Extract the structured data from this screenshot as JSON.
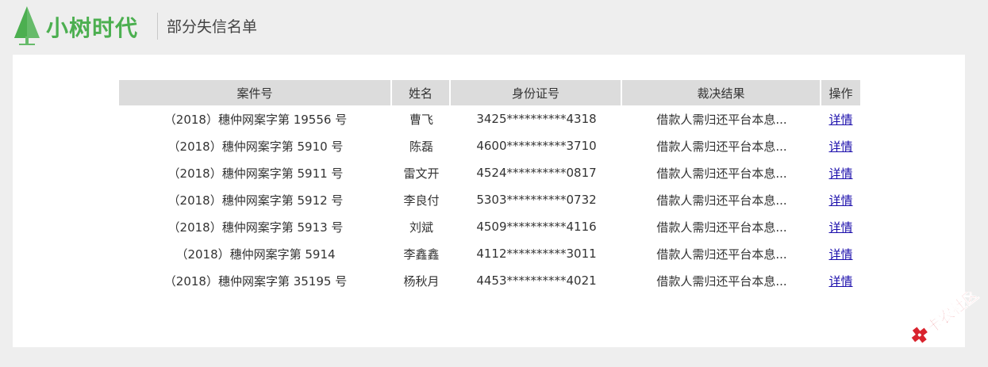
{
  "header": {
    "brand": "小树时代",
    "page_title": "部分失信名单",
    "brand_color": "#4caf50"
  },
  "table": {
    "columns": [
      "案件号",
      "姓名",
      "身份证号",
      "裁决结果",
      "操作"
    ],
    "rows": [
      {
        "case_no": "（2018）穗仲网案字第 19556 号",
        "name": "曹飞",
        "id_no": "3425**********4318",
        "result": "借款人需归还平台本息...",
        "action": "详情"
      },
      {
        "case_no": "（2018）穗仲网案字第 5910 号",
        "name": "陈磊",
        "id_no": "4600**********3710",
        "result": "借款人需归还平台本息...",
        "action": "详情"
      },
      {
        "case_no": "（2018）穗仲网案字第 5911 号",
        "name": "雷文开",
        "id_no": "4524**********0817",
        "result": "借款人需归还平台本息...",
        "action": "详情"
      },
      {
        "case_no": "（2018）穗仲网案字第 5912 号",
        "name": "李良付",
        "id_no": "5303**********0732",
        "result": "借款人需归还平台本息...",
        "action": "详情"
      },
      {
        "case_no": "（2018）穗仲网案字第 5913 号",
        "name": "刘斌",
        "id_no": "4509**********4116",
        "result": "借款人需归还平台本息...",
        "action": "详情"
      },
      {
        "case_no": "（2018）穗仲网案字第 5914",
        "name": "李鑫鑫",
        "id_no": "4112**********3011",
        "result": "借款人需归还平台本息...",
        "action": "详情"
      },
      {
        "case_no": "（2018）穗仲网案字第 35195 号",
        "name": "杨秋月",
        "id_no": "4453**********4021",
        "result": "借款人需归还平台本息...",
        "action": "详情"
      }
    ]
  },
  "watermark": {
    "text": "卡农社区",
    "color": "#d9232d"
  }
}
